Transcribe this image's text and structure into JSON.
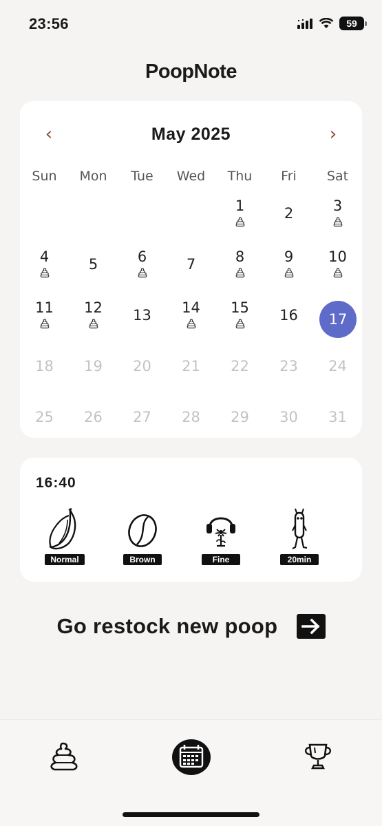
{
  "status_bar": {
    "time": "23:56",
    "battery": "59",
    "icons": [
      "cellular-signal-icon",
      "wifi-icon",
      "battery-icon"
    ]
  },
  "app": {
    "title": "PoopNote"
  },
  "calendar": {
    "month_label": "May 2025",
    "prev_icon": "‹",
    "next_icon": "›",
    "weekdays": [
      "Sun",
      "Mon",
      "Tue",
      "Wed",
      "Thu",
      "Fri",
      "Sat"
    ],
    "days": [
      {
        "day": "1",
        "logged": true,
        "muted": false
      },
      {
        "day": "2",
        "logged": false,
        "muted": false
      },
      {
        "day": "3",
        "logged": true,
        "muted": false
      },
      {
        "day": "4",
        "logged": true,
        "muted": false
      },
      {
        "day": "5",
        "logged": false,
        "muted": false
      },
      {
        "day": "6",
        "logged": true,
        "muted": false
      },
      {
        "day": "7",
        "logged": false,
        "muted": false
      },
      {
        "day": "8",
        "logged": true,
        "muted": false
      },
      {
        "day": "9",
        "logged": true,
        "muted": false
      },
      {
        "day": "10",
        "logged": true,
        "muted": false
      },
      {
        "day": "11",
        "logged": true,
        "muted": false
      },
      {
        "day": "12",
        "logged": true,
        "muted": false
      },
      {
        "day": "13",
        "logged": false,
        "muted": false
      },
      {
        "day": "14",
        "logged": true,
        "muted": false
      },
      {
        "day": "15",
        "logged": true,
        "muted": false
      },
      {
        "day": "16",
        "logged": false,
        "muted": false
      },
      {
        "day": "17",
        "logged": false,
        "muted": false,
        "selected": true
      },
      {
        "day": "18",
        "logged": false,
        "muted": true
      },
      {
        "day": "19",
        "logged": false,
        "muted": true
      },
      {
        "day": "20",
        "logged": false,
        "muted": true
      },
      {
        "day": "21",
        "logged": false,
        "muted": true
      },
      {
        "day": "22",
        "logged": false,
        "muted": true
      },
      {
        "day": "23",
        "logged": false,
        "muted": true
      },
      {
        "day": "24",
        "logged": false,
        "muted": true
      },
      {
        "day": "25",
        "logged": false,
        "muted": true
      },
      {
        "day": "26",
        "logged": false,
        "muted": true
      },
      {
        "day": "27",
        "logged": false,
        "muted": true
      },
      {
        "day": "28",
        "logged": false,
        "muted": true
      },
      {
        "day": "29",
        "logged": false,
        "muted": true
      },
      {
        "day": "30",
        "logged": false,
        "muted": true
      },
      {
        "day": "31",
        "logged": false,
        "muted": true
      }
    ],
    "selected_color": "#5f6bc9",
    "nav_color": "#8a4c33"
  },
  "entry": {
    "time": "16:40",
    "items": [
      {
        "icon": "banana-icon",
        "label": "Normal"
      },
      {
        "icon": "coffee-bean-icon",
        "label": "Brown"
      },
      {
        "icon": "headphone-flower-icon",
        "label": "Fine"
      },
      {
        "icon": "walking-creature-icon",
        "label": "20min"
      }
    ]
  },
  "restock": {
    "label": "Go restock new poop",
    "icon": "arrow-right-icon"
  },
  "tabs": [
    {
      "name": "poop-tab",
      "icon": "poop-icon",
      "active": false
    },
    {
      "name": "calendar-tab",
      "icon": "calendar-icon",
      "active": true
    },
    {
      "name": "trophy-tab",
      "icon": "trophy-icon",
      "active": false
    }
  ]
}
